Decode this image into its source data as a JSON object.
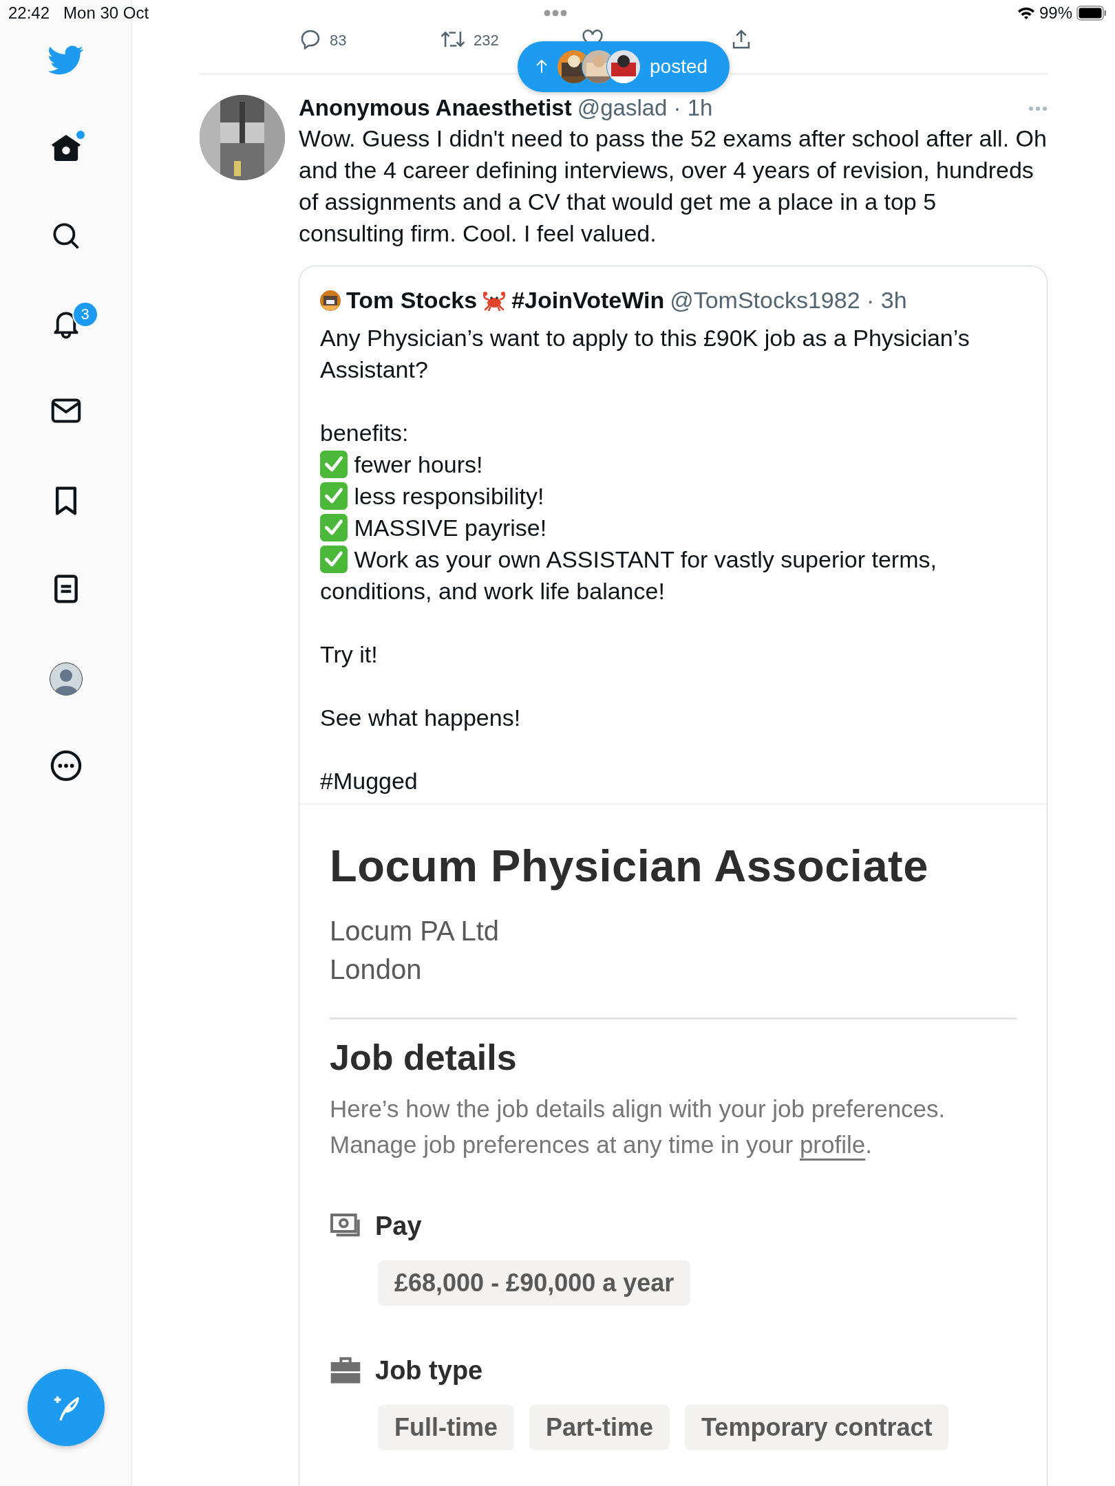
{
  "status_bar": {
    "time": "22:42",
    "date": "Mon 30 Oct",
    "battery": "99%"
  },
  "sidebar": {
    "items": [
      {
        "kind": "logo"
      },
      {
        "kind": "home",
        "has_new": true
      },
      {
        "kind": "search"
      },
      {
        "kind": "notifications",
        "badge": "3"
      },
      {
        "kind": "messages"
      },
      {
        "kind": "bookmarks"
      },
      {
        "kind": "lists"
      },
      {
        "kind": "profile"
      },
      {
        "kind": "more"
      }
    ]
  },
  "previous_tweet_actions": [
    {
      "kind": "reply",
      "count": "83"
    },
    {
      "kind": "retweet",
      "count": "232"
    },
    {
      "kind": "like"
    },
    {
      "kind": "share"
    }
  ],
  "new_posts_pill": {
    "label": "posted"
  },
  "tweet": {
    "author": "Anonymous Anaesthetist",
    "meta": "@gaslad · 1h",
    "text": "Wow. Guess I didn't need to pass the 52 exams after school after all. Oh and the 4 career defining interviews, over 4 years of revision, hundreds of assignments and a CV that would get me a place in a top 5 consulting firm. Cool. I feel valued.",
    "quote": {
      "author": "Tom Stocks",
      "hashtag": "#JoinVoteWin",
      "meta": "@TomStocks1982 · 3h",
      "paragraphs": [
        {
          "lines": [
            {
              "kind": "text",
              "text": "Any Physician’s want to apply to this £90K job as a Physician’s Assistant?"
            }
          ]
        },
        {
          "lines": [
            {
              "kind": "text",
              "text": "benefits:"
            },
            {
              "kind": "check",
              "text": "fewer hours!"
            },
            {
              "kind": "check",
              "text": "less responsibility!"
            },
            {
              "kind": "check",
              "text": "MASSIVE payrise!"
            },
            {
              "kind": "check",
              "text": "Work as your own ASSISTANT for vastly superior terms,"
            },
            {
              "kind": "text",
              "text": "conditions, and work life balance!"
            }
          ]
        },
        {
          "lines": [
            {
              "kind": "text",
              "text": "Try it!"
            }
          ]
        },
        {
          "lines": [
            {
              "kind": "text",
              "text": "See what happens!"
            }
          ]
        },
        {
          "lines": [
            {
              "kind": "text",
              "text": "#Mugged"
            }
          ]
        }
      ],
      "job": {
        "title": "Locum Physician Associate",
        "company": "Locum PA Ltd",
        "location": "London",
        "section": "Job details",
        "desc_before": "Here’s how the job details align with your job preferences. Manage job preferences at any time in your ",
        "desc_link": "profile",
        "desc_after": ".",
        "groups": [
          {
            "kind": "pay",
            "label": "Pay",
            "tags": [
              "£68,000 - £90,000 a year"
            ]
          },
          {
            "kind": "job_type",
            "label": "Job type",
            "tags": [
              "Full-time",
              "Part-time",
              "Temporary contract"
            ]
          }
        ]
      }
    }
  }
}
